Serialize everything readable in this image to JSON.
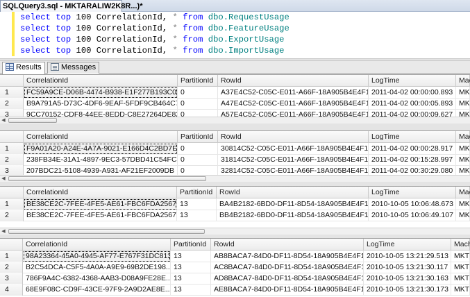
{
  "document_tab": {
    "title": "SQLQuery3.sql - MKTARALIW2K8R...)*"
  },
  "editor": {
    "lines": [
      {
        "k1": "select",
        "k2": "top",
        "num": "100",
        "col": "CorrelationId,",
        "star": "*",
        "k3": "from",
        "obj": "dbo.RequestUsage"
      },
      {
        "k1": "select",
        "k2": "top",
        "num": "100",
        "col": "CorrelationId,",
        "star": "*",
        "k3": "from",
        "obj": "dbo.FeatureUsage"
      },
      {
        "k1": "select",
        "k2": "top",
        "num": "100",
        "col": "CorrelationId,",
        "star": "*",
        "k3": "from",
        "obj": "dbo.ExportUsage"
      },
      {
        "k1": "select",
        "k2": "top",
        "num": "100",
        "col": "CorrelationId,",
        "star": "*",
        "k3": "from",
        "obj": "dbo.ImportUsage"
      }
    ]
  },
  "result_tabs": {
    "results": "Results",
    "messages": "Messages"
  },
  "grids": [
    {
      "columns": [
        "CorrelationId",
        "PartitionId",
        "RowId",
        "LogTime",
        "Mac"
      ],
      "rows": [
        [
          "1",
          "FC59A9CE-D06B-4474-B938-E1F277B193C0",
          "0",
          "A37E4C52-C05C-E011-A66F-18A905B4E4F1",
          "2011-04-02 00:00:00.893",
          "MK"
        ],
        [
          "2",
          "B9A791A5-D73C-4DF6-9EAF-5FDF9CB464C7",
          "0",
          "A47E4C52-C05C-E011-A66F-18A905B4E4F1",
          "2011-04-02 00:00:05.893",
          "MK"
        ],
        [
          "3",
          "9CC70152-CDF8-44EE-8EDD-C8E27264DE82",
          "0",
          "A57E4C52-C05C-E011-A66F-18A905B4E4F1",
          "2011-04-02 00:00:09.627",
          "MK"
        ]
      ]
    },
    {
      "columns": [
        "CorrelationId",
        "PartitionId",
        "RowId",
        "LogTime",
        "Mac"
      ],
      "rows": [
        [
          "1",
          "F9A01A20-A24E-4A7A-9021-E166D4C2BD7E",
          "0",
          "30814C52-C05C-E011-A66F-18A905B4E4F1",
          "2011-04-02 00:00:28.917",
          "MK"
        ],
        [
          "2",
          "238FB34E-31A1-4897-9EC3-57DBD41C54FC",
          "0",
          "31814C52-C05C-E011-A66F-18A905B4E4F1",
          "2011-04-02 00:15:28.997",
          "MK"
        ],
        [
          "3",
          "207BDC21-5108-4939-A931-AF21EF2009DB",
          "0",
          "32814C52-C05C-E011-A66F-18A905B4E4F1",
          "2011-04-02 00:30:29.080",
          "MK"
        ]
      ]
    },
    {
      "columns": [
        "CorrelationId",
        "PartitionId",
        "RowId",
        "LogTime",
        "Mac"
      ],
      "rows": [
        [
          "1",
          "BE38CE2C-7FEE-4FE5-AE61-FBC6FDA2567F",
          "13",
          "BA4B2182-6BD0-DF11-8D54-18A905B4E4F1",
          "2010-10-05 10:06:48.673",
          "MK"
        ],
        [
          "2",
          "BE38CE2C-7FEE-4FE5-AE61-FBC6FDA2567F",
          "13",
          "BB4B2182-6BD0-DF11-8D54-18A905B4E4F1",
          "2010-10-05 10:06:49.107",
          "MK"
        ]
      ]
    },
    {
      "columns": [
        "CorrelationId",
        "PartitionId",
        "RowId",
        "LogTime",
        "Mach"
      ],
      "rows": [
        [
          "1",
          "98A23364-45A0-4945-AF77-E767F31DC813",
          "13",
          "AB8BACA7-84D0-DF11-8D54-18A905B4E4F1",
          "2010-10-05 13:21:29.513",
          "MKT"
        ],
        [
          "2",
          "B2C54DCA-C5F5-4A0A-A9E9-69B2DE198...",
          "13",
          "AC8BACA7-84D0-DF11-8D54-18A905B4E4F1",
          "2010-10-05 13:21:30.117",
          "MKT"
        ],
        [
          "3",
          "786F9A4C-6382-4368-AAB3-D08A9FE28E...",
          "13",
          "AD8BACA7-84D0-DF11-8D54-18A905B4E4F1",
          "2010-10-05 13:21:30.163",
          "MKT"
        ],
        [
          "4",
          "68E9F08C-CD9F-43CE-97F9-2A9D2AE8E...",
          "13",
          "AE8BACA7-84D0-DF11-8D54-18A905B4E4F1",
          "2010-10-05 13:21:30.173",
          "MKT"
        ]
      ]
    }
  ],
  "colors": {
    "keyword": "#0000ff",
    "object": "#008080",
    "operator": "#808080",
    "change_bar": "#ffe84d"
  }
}
